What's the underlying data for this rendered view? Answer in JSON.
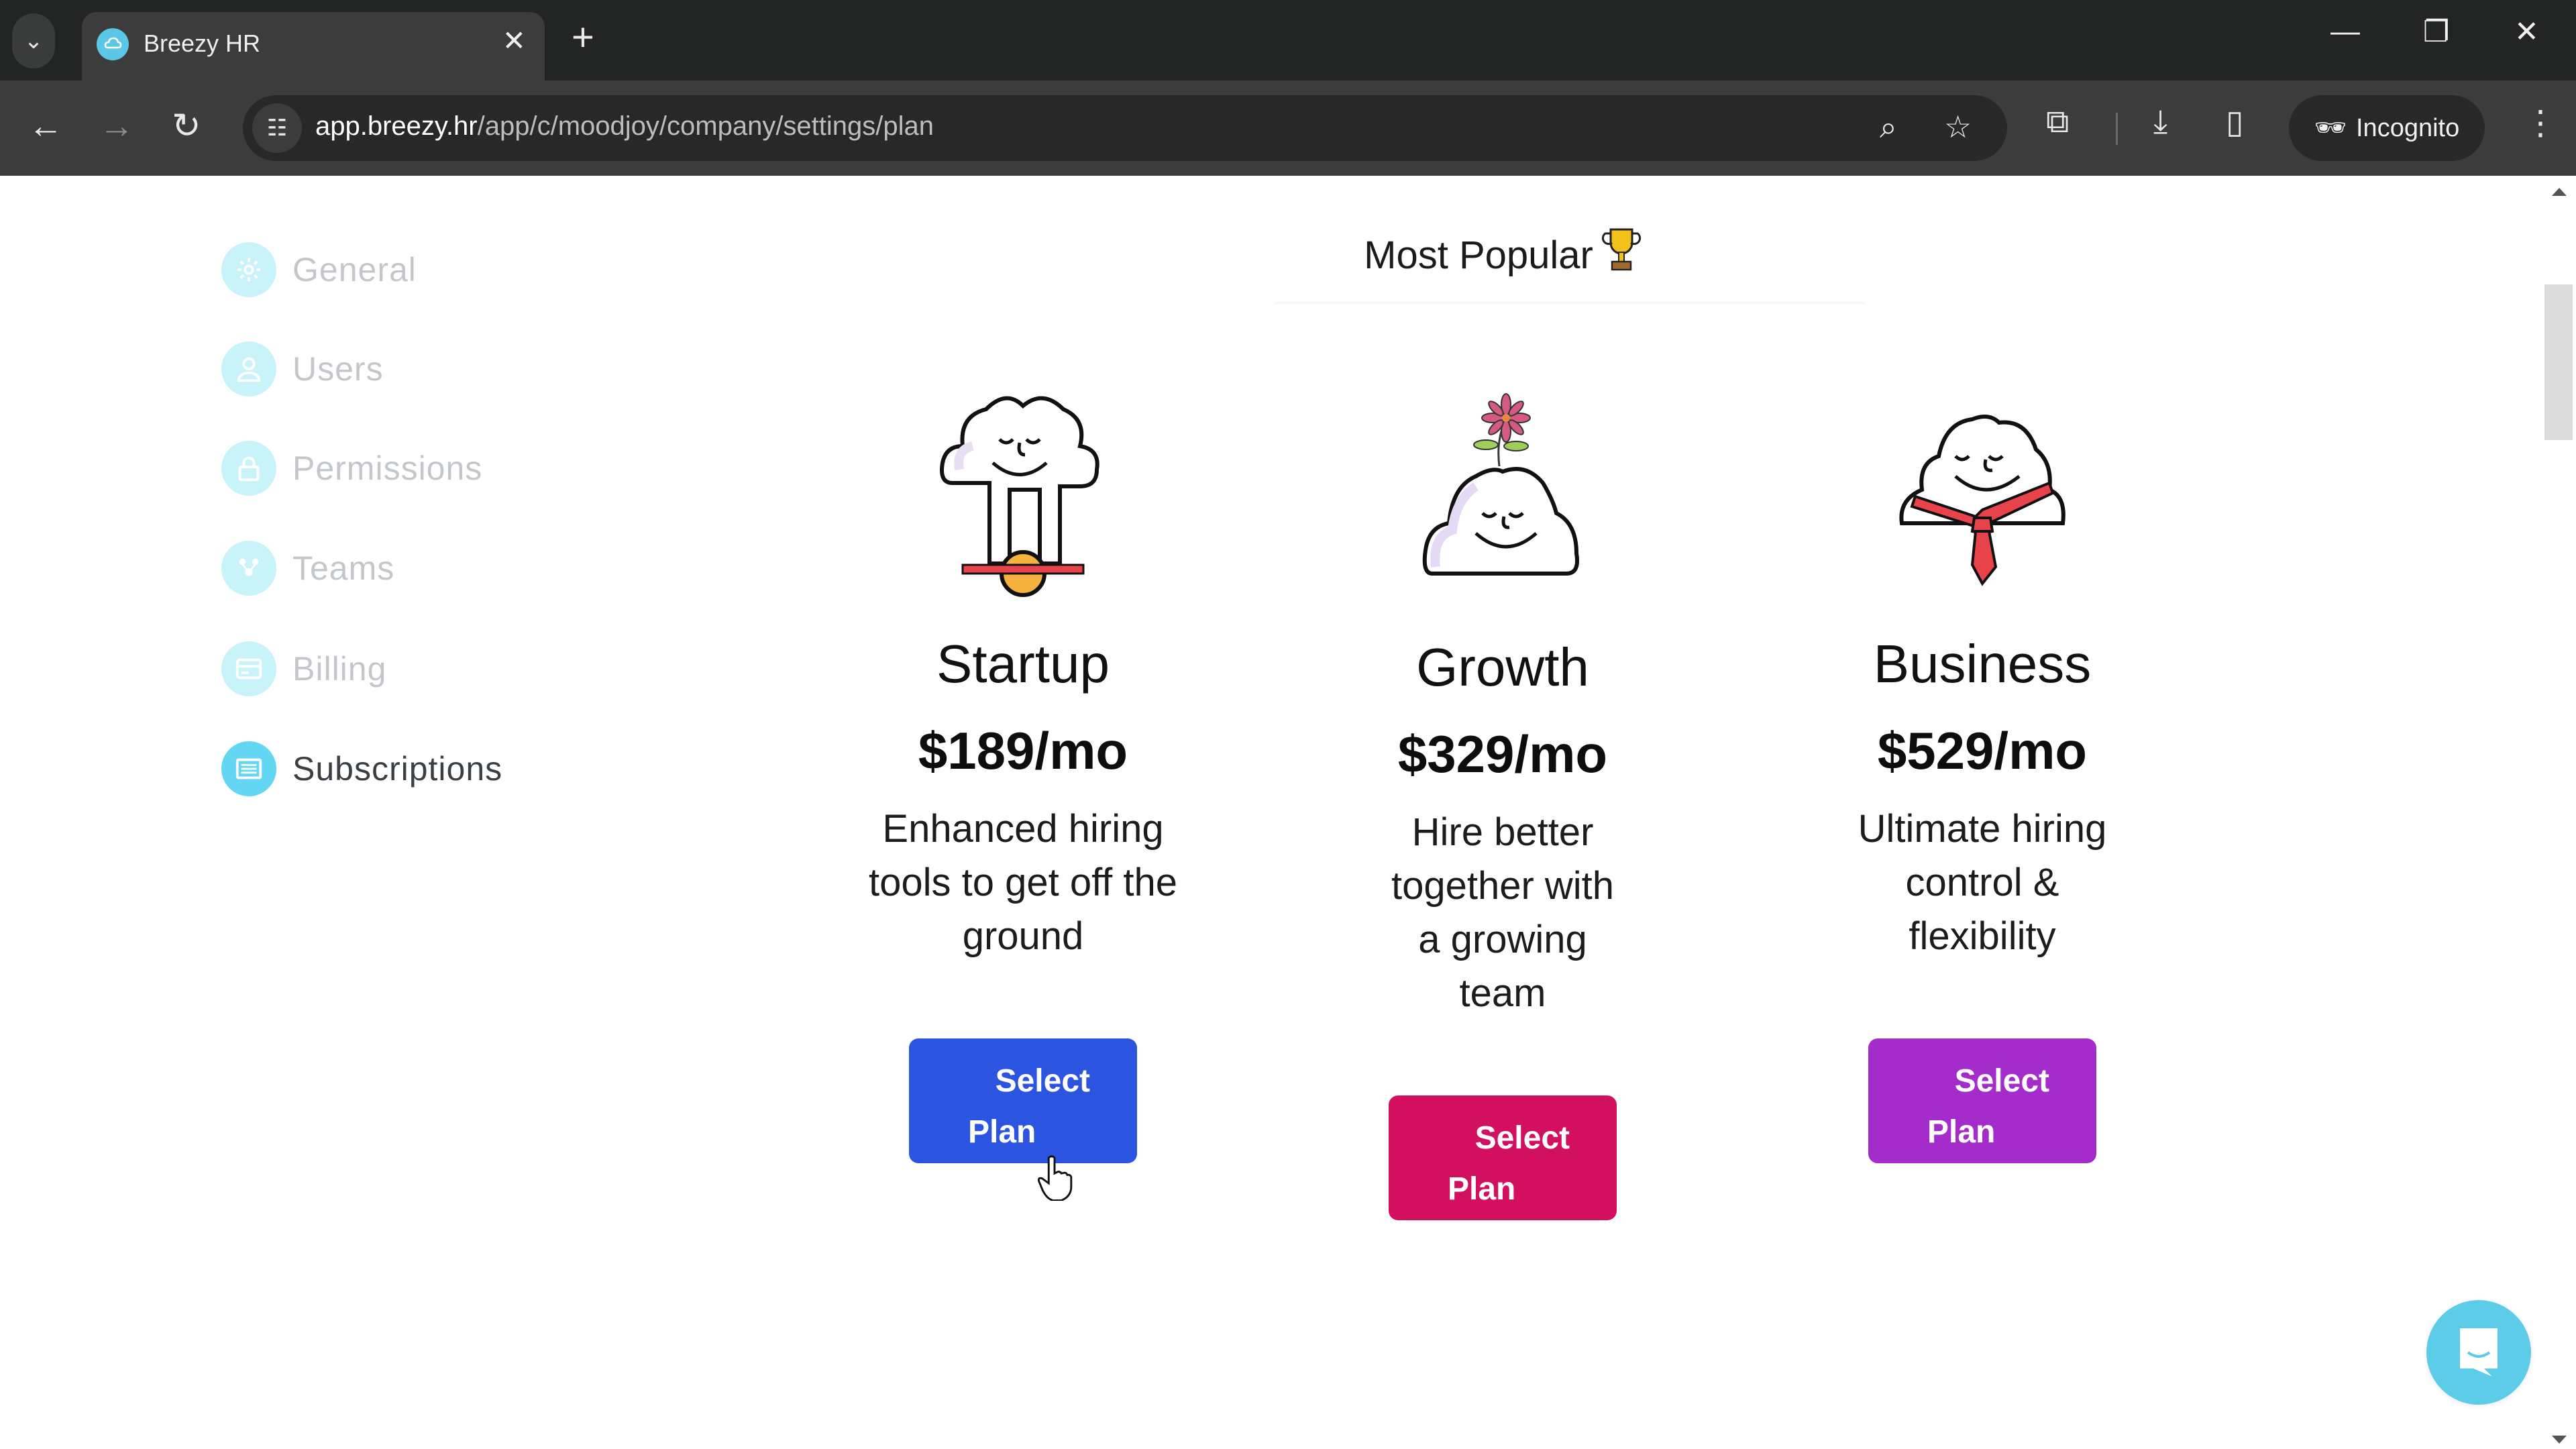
{
  "browser": {
    "tab_title": "Breezy HR",
    "url_host": "app.breezy.hr",
    "url_path": "/app/c/moodjoy/company/settings/plan",
    "incognito_label": "Incognito"
  },
  "sidebar": {
    "items": [
      {
        "label": "General",
        "icon": "gear-icon",
        "active": false
      },
      {
        "label": "Users",
        "icon": "user-icon",
        "active": false
      },
      {
        "label": "Permissions",
        "icon": "lock-icon",
        "active": false
      },
      {
        "label": "Teams",
        "icon": "team-icon",
        "active": false
      },
      {
        "label": "Billing",
        "icon": "billing-icon",
        "active": false
      },
      {
        "label": "Subscriptions",
        "icon": "subscriptions-icon",
        "active": true
      }
    ]
  },
  "main": {
    "most_popular_label": "Most Popular",
    "most_popular_icon": "trophy-icon",
    "plans": [
      {
        "name": "Startup",
        "price": "$189/mo",
        "description": "Enhanced hiring tools to get off the ground",
        "button_label_1": "Select",
        "button_label_2": "Plan",
        "button_color": "#2b55e0",
        "illustration": "cloud-unicycle-illustration"
      },
      {
        "name": "Growth",
        "price": "$329/mo",
        "description": "Hire better together with a growing team",
        "button_label_1": "Select",
        "button_label_2": "Plan",
        "button_color": "#d3105f",
        "illustration": "cloud-flower-illustration"
      },
      {
        "name": "Business",
        "price": "$529/mo",
        "description": "Ultimate hiring control & flexibility",
        "button_label_1": "Select",
        "button_label_2": "Plan",
        "button_color": "#a42ccb",
        "illustration": "cloud-tie-illustration"
      }
    ]
  },
  "chat": {
    "icon": "chat-icon"
  }
}
